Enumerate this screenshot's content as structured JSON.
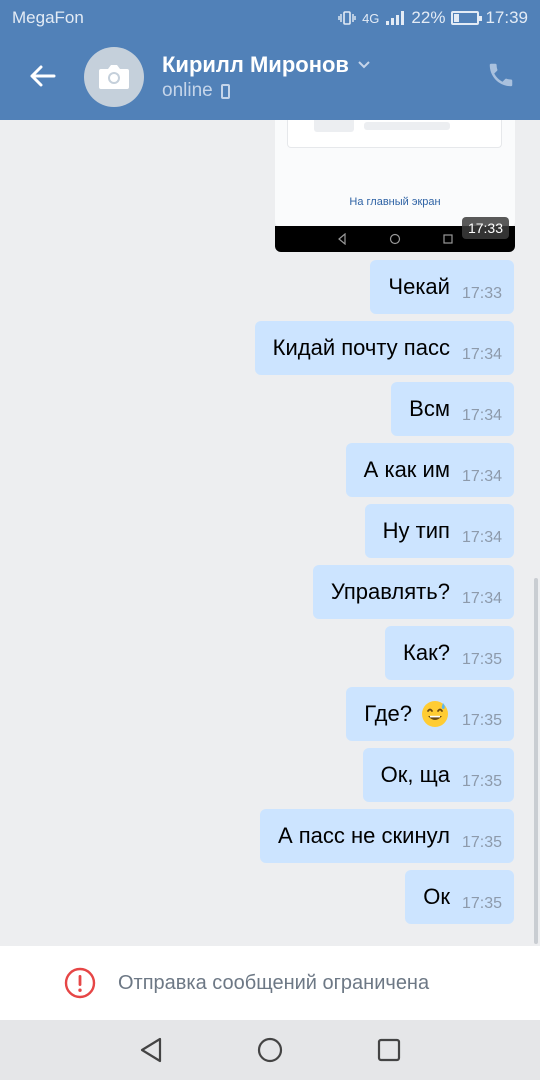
{
  "status_bar": {
    "carrier": "MegaFon",
    "network": "4G",
    "battery_percent": "22%",
    "battery_level": 0.22,
    "time": "17:39"
  },
  "header": {
    "contact_name": "Кирилл Миронов",
    "presence": "online",
    "icons": [
      "back-arrow-icon",
      "camera-icon",
      "chevron-down-icon",
      "mobile-icon",
      "phone-icon"
    ]
  },
  "image_message": {
    "link_text": "На главный экран",
    "time": "17:33"
  },
  "messages": [
    {
      "text": "Чекай",
      "time": "17:33"
    },
    {
      "text": "Кидай почту пасс",
      "time": "17:34"
    },
    {
      "text": "Всм",
      "time": "17:34"
    },
    {
      "text": "А как им",
      "time": "17:34"
    },
    {
      "text": "Ну тип",
      "time": "17:34"
    },
    {
      "text": "Управлять?",
      "time": "17:34"
    },
    {
      "text": "Как?",
      "time": "17:35"
    },
    {
      "text": "Где?",
      "time": "17:35",
      "emoji": "sweat-smile-emoji"
    },
    {
      "text": "Ок, ща",
      "time": "17:35"
    },
    {
      "text": "А пасс не скинул",
      "time": "17:35"
    },
    {
      "text": "Ок",
      "time": "17:35"
    }
  ],
  "banner": {
    "text": "Отправка сообщений ограничена",
    "icon": "warning-circle-icon"
  },
  "colors": {
    "header_bg": "#5181b8",
    "bubble_bg": "#cce4ff",
    "chat_bg": "#edeef0",
    "warning": "#e64646"
  }
}
